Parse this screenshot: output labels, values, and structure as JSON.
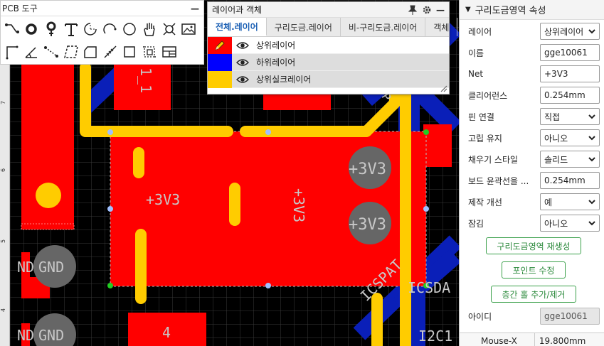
{
  "pcb_tools": {
    "title": "PCB 도구",
    "minimize": "—"
  },
  "layers_panel": {
    "title": "레이어과 객체",
    "tabs": [
      "전체.레이어",
      "구리도금.레이어",
      "비-구리도금.레이어",
      "객체"
    ],
    "layers": [
      {
        "name": "상위레이어",
        "color": "#ff0000"
      },
      {
        "name": "하위레이어",
        "color": "#0000ff"
      },
      {
        "name": "상위실크레이어",
        "color": "#ffcc00"
      }
    ]
  },
  "canvas": {
    "ruler_labels": [
      "7",
      "6",
      "5",
      "4"
    ],
    "silk": {
      "u1": "1_1",
      "pad_3v3_a": "+3V3",
      "pad_3v3_b": "+3V3",
      "net_3v3_h": "+3V3",
      "net_3v3_v": "+3V3",
      "icspat": "ICSPAT",
      "icsda": "ICSDA",
      "gnd1": "GND",
      "gnd2": "GND",
      "gnd_cut1": "ND",
      "gnd_cut2": "ND",
      "pad4": "4",
      "i2c": "I2C1",
      "pp": "P"
    }
  },
  "properties": {
    "title": "구리도금영역 속성",
    "rows": [
      {
        "label": "레이어",
        "value": "상위레이어",
        "type": "select"
      },
      {
        "label": "이름",
        "value": "gge10061",
        "type": "input"
      },
      {
        "label": "Net",
        "value": "+3V3",
        "type": "input"
      },
      {
        "label": "클리어런스",
        "value": "0.254mm",
        "type": "input"
      },
      {
        "label": "핀 연결",
        "value": "직접",
        "type": "select"
      },
      {
        "label": "고립 유지",
        "value": "아니오",
        "type": "select"
      },
      {
        "label": "채우기 스타일",
        "value": "솔리드",
        "type": "select"
      },
      {
        "label": "보드 윤곽선을 ...",
        "value": "0.254mm",
        "type": "input"
      },
      {
        "label": "제작 개선",
        "value": "예",
        "type": "select"
      },
      {
        "label": "잠김",
        "value": "아니오",
        "type": "select"
      }
    ],
    "buttons": {
      "regenerate": "구리도금영역 재생성",
      "edit_points": "포인트 수정",
      "interlayer": "층간 홀 추가/제거"
    },
    "id_label": "아이디",
    "id_value": "gge10061",
    "mouse_x_label": "Mouse-X",
    "mouse_x_value": "19.800mm"
  },
  "colors": {
    "top": "#ff0000",
    "bottom": "#0000ff",
    "silk": "#ffcc00",
    "accent_green": "#3aa04a"
  }
}
